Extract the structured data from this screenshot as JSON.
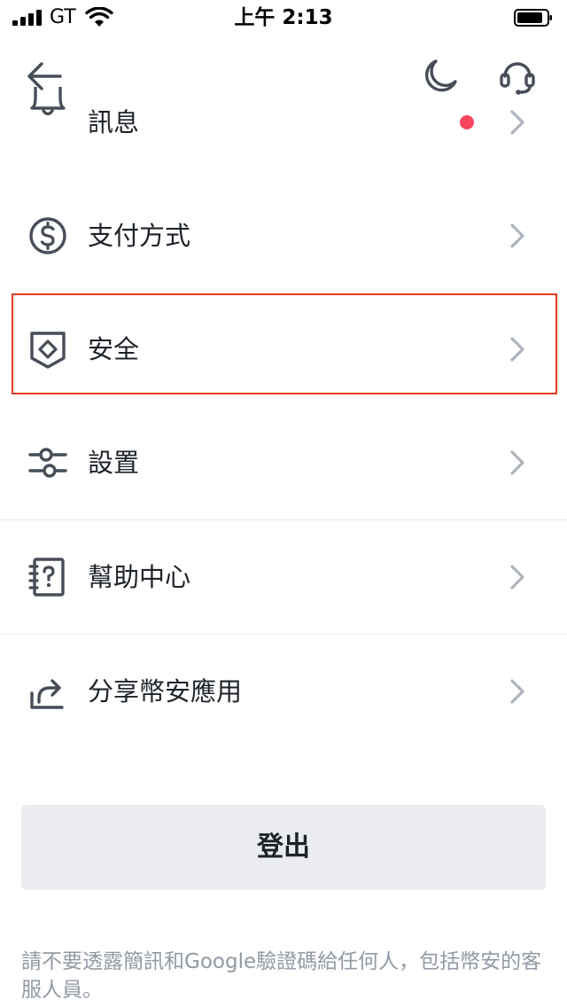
{
  "status_bar": {
    "carrier": "GT",
    "time": "上午 2:13"
  },
  "nav": {
    "icons": [
      "back-arrow-icon",
      "moon-icon",
      "headset-icon"
    ]
  },
  "menu": {
    "items": [
      {
        "label": "訊息",
        "icon": "bell-icon",
        "has_notification_dot": true
      },
      {
        "label": "支付方式",
        "icon": "dollar-circle-icon"
      },
      {
        "label": "安全",
        "icon": "shield-icon",
        "highlighted": true
      },
      {
        "label": "設置",
        "icon": "sliders-icon"
      },
      {
        "label": "幫助中心",
        "icon": "help-notebook-icon"
      },
      {
        "label": "分享幣安應用",
        "icon": "share-icon"
      }
    ]
  },
  "logout": {
    "label": "登出"
  },
  "warning": {
    "text": "請不要透露簡訊和Google驗證碼給任何人，包括幣安的客服人員。"
  },
  "colors": {
    "text": "#1e2329",
    "icon": "#474d57",
    "chevron": "#aeb4bc",
    "notification_dot": "#f6465d",
    "highlight_border": "#e53b22",
    "button_bg": "#eaecef",
    "muted_text": "#929aa5"
  }
}
